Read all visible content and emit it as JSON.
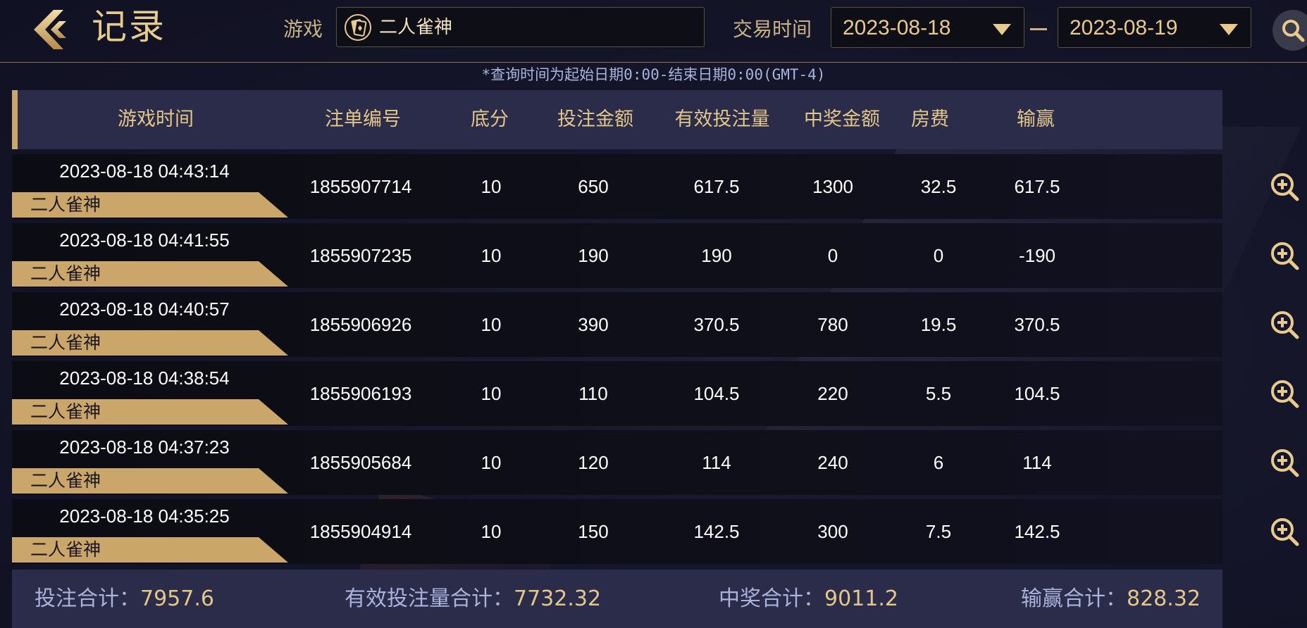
{
  "header": {
    "title": "记录",
    "game_label": "游戏",
    "game_value": "二人雀神",
    "time_label": "交易时间",
    "date_from": "2023-08-18",
    "date_to": "2023-08-19"
  },
  "notice": "*查询时间为起始日期0:00-结束日期0:00(GMT-4)",
  "columns": [
    "游戏时间",
    "注单编号",
    "底分",
    "投注金额",
    "有效投注量",
    "中奖金额",
    "房费",
    "输赢"
  ],
  "rows": [
    {
      "time": "2023-08-18 04:43:14",
      "game": "二人雀神",
      "id": "1855907714",
      "base": "10",
      "bet": "650",
      "valid": "617.5",
      "win": "1300",
      "fee": "32.5",
      "result": "617.5"
    },
    {
      "time": "2023-08-18 04:41:55",
      "game": "二人雀神",
      "id": "1855907235",
      "base": "10",
      "bet": "190",
      "valid": "190",
      "win": "0",
      "fee": "0",
      "result": "-190"
    },
    {
      "time": "2023-08-18 04:40:57",
      "game": "二人雀神",
      "id": "1855906926",
      "base": "10",
      "bet": "390",
      "valid": "370.5",
      "win": "780",
      "fee": "19.5",
      "result": "370.5"
    },
    {
      "time": "2023-08-18 04:38:54",
      "game": "二人雀神",
      "id": "1855906193",
      "base": "10",
      "bet": "110",
      "valid": "104.5",
      "win": "220",
      "fee": "5.5",
      "result": "104.5"
    },
    {
      "time": "2023-08-18 04:37:23",
      "game": "二人雀神",
      "id": "1855905684",
      "base": "10",
      "bet": "120",
      "valid": "114",
      "win": "240",
      "fee": "6",
      "result": "114"
    },
    {
      "time": "2023-08-18 04:35:25",
      "game": "二人雀神",
      "id": "1855904914",
      "base": "10",
      "bet": "150",
      "valid": "142.5",
      "win": "300",
      "fee": "7.5",
      "result": "142.5"
    }
  ],
  "totals": {
    "bet_label": "投注合计：",
    "bet_value": "7957.6",
    "valid_label": "有效投注量合计：",
    "valid_value": "7732.32",
    "win_label": "中奖合计：",
    "win_value": "9011.2",
    "result_label": "输赢合计：",
    "result_value": "828.32"
  },
  "icons": {
    "back": "chevron-left-icon",
    "game": "playing-card-icon",
    "search": "search-icon",
    "detail": "zoom-in-icon"
  },
  "colors": {
    "accent_gold": "#caa66a",
    "gold_text": "#e8c98e",
    "label_blue": "#a9b3dc",
    "panel": "#2b2c4a"
  }
}
